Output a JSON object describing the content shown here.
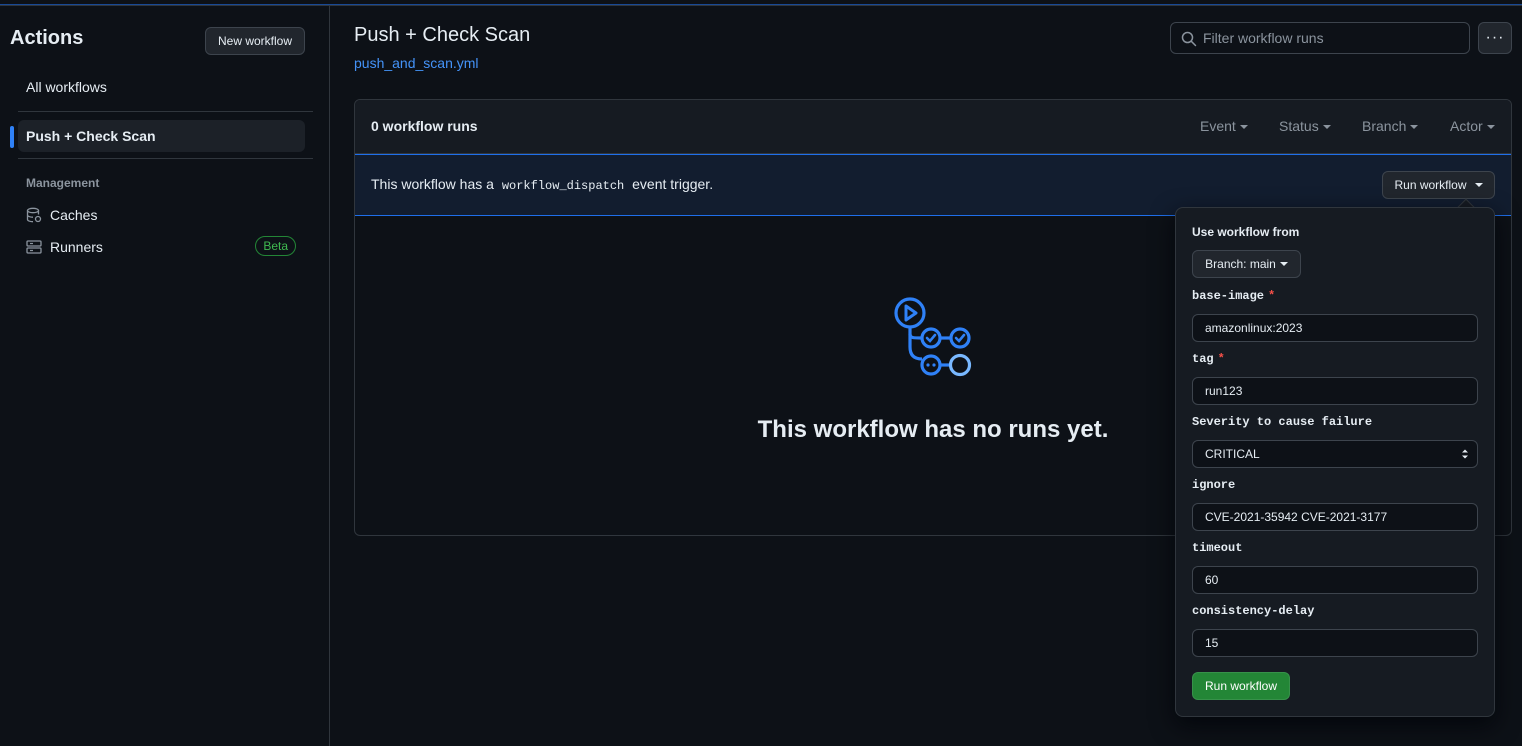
{
  "sidebar": {
    "title": "Actions",
    "new_workflow_label": "New workflow",
    "all_workflows_label": "All workflows",
    "active_workflow_label": "Push + Check Scan",
    "management_heading": "Management",
    "caches_label": "Caches",
    "runners_label": "Runners",
    "runners_badge": "Beta"
  },
  "header": {
    "title": "Push + Check Scan",
    "file_link": "push_and_scan.yml",
    "filter_placeholder": "Filter workflow runs",
    "more_label": "···"
  },
  "runs": {
    "count_label": "0 workflow runs",
    "filters": [
      "Event",
      "Status",
      "Branch",
      "Actor"
    ],
    "dispatch_prefix": "This workflow has a",
    "dispatch_code": "workflow_dispatch",
    "dispatch_suffix": "event trigger.",
    "run_workflow_label": "Run workflow",
    "empty_message": "This workflow has no runs yet."
  },
  "popover": {
    "use_from_label": "Use workflow from",
    "branch_label": "Branch: main",
    "inputs": [
      {
        "label": "base-image",
        "required": true,
        "value": "amazonlinux:2023"
      },
      {
        "label": "tag",
        "required": true,
        "value": "run123"
      },
      {
        "label": "Severity to cause failure",
        "required": false,
        "value": "CRITICAL",
        "type": "select"
      },
      {
        "label": "ignore",
        "required": false,
        "value": "CVE-2021-35942 CVE-2021-3177"
      },
      {
        "label": "timeout",
        "required": false,
        "value": "60"
      },
      {
        "label": "consistency-delay",
        "required": false,
        "value": "15"
      }
    ],
    "required_marker": "*",
    "submit_label": "Run workflow"
  },
  "colors": {
    "background": "#0d1117",
    "accent_blue": "#2f81f7",
    "link_blue": "#4493f8",
    "success_green": "#238636",
    "required_red": "#f85149"
  },
  "icons": [
    "database-icon",
    "server-icon",
    "search-icon",
    "workflow-graph-icon",
    "caret-down-icon"
  ]
}
